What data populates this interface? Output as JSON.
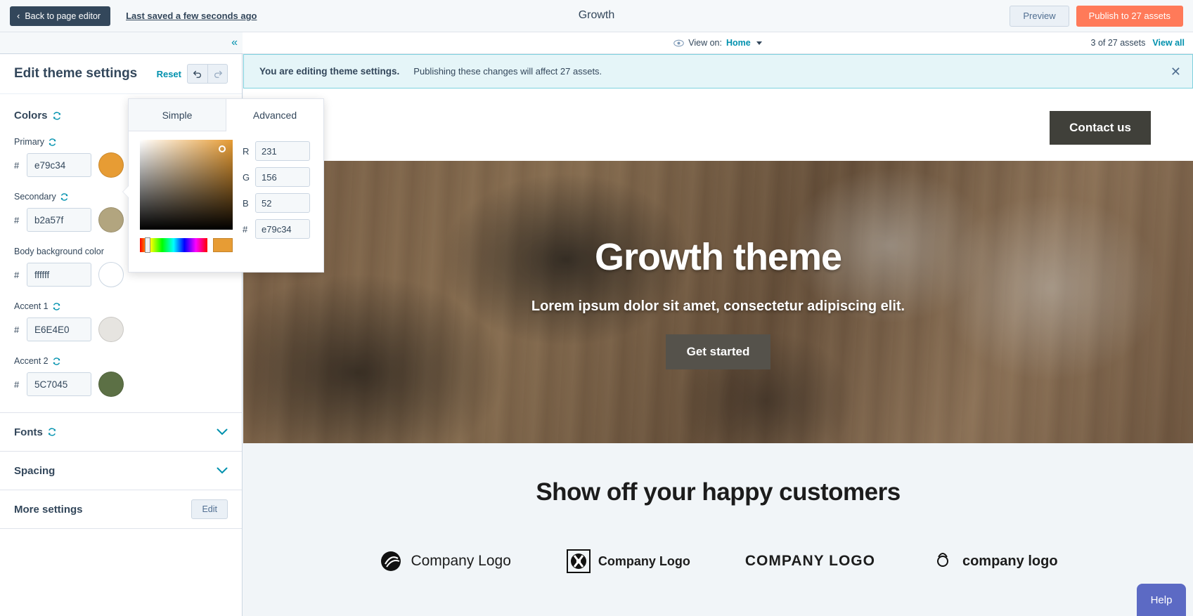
{
  "topbar": {
    "back_label": "Back to page editor",
    "back_chevron": "chevron-left-icon",
    "last_saved": "Last saved a few seconds ago",
    "page_title": "Growth",
    "preview_label": "Preview",
    "publish_label": "Publish to 27 assets",
    "publish_color": "#ff7a59",
    "back_color": "#33475b"
  },
  "secondbar": {
    "eye_icon": "eye-icon",
    "view_on_label": "View on:",
    "view_on_value": "Home",
    "assets_count": "3 of 27 assets",
    "view_all": "View all",
    "link_color": "#0091ae"
  },
  "sidebar": {
    "collapse_icon": "double-chevron-left-icon",
    "title": "Edit theme settings",
    "reset_label": "Reset",
    "undo_icon": "undo-icon",
    "redo_icon": "redo-icon",
    "colors_section": {
      "label": "Colors",
      "reset_icon": "refresh-icon",
      "fields": [
        {
          "label": "Primary",
          "has_reset": true,
          "reset_icon": "refresh-icon",
          "hash": "#",
          "value": "e79c34",
          "swatch": "#e79c34"
        },
        {
          "label": "Secondary",
          "has_reset": true,
          "reset_icon": "refresh-icon",
          "hash": "#",
          "value": "b2a57f",
          "swatch": "#b2a57f"
        },
        {
          "label": "Body background color",
          "has_reset": false,
          "reset_icon": "",
          "hash": "#",
          "value": "ffffff",
          "swatch": "#ffffff"
        },
        {
          "label": "Accent 1",
          "has_reset": true,
          "reset_icon": "refresh-icon",
          "hash": "#",
          "value": "E6E4E0",
          "swatch": "#E6E4E0"
        },
        {
          "label": "Accent 2",
          "has_reset": true,
          "reset_icon": "refresh-icon",
          "hash": "#",
          "value": "5C7045",
          "swatch": "#5C7045"
        }
      ]
    },
    "fonts_section": {
      "label": "Fonts",
      "reset_icon": "refresh-icon",
      "chevron": "chevron-down-icon"
    },
    "spacing_section": {
      "label": "Spacing",
      "chevron": "chevron-down-icon"
    },
    "more_settings": {
      "label": "More settings",
      "edit_label": "Edit"
    }
  },
  "picker": {
    "tab_simple": "Simple",
    "tab_advanced": "Advanced",
    "active_tab": "Advanced",
    "r_label": "R",
    "r_value": "231",
    "g_label": "G",
    "g_value": "156",
    "b_label": "B",
    "b_value": "52",
    "hex_label": "#",
    "hex_value": "e79c34",
    "current_color": "#e79c34"
  },
  "banner": {
    "bold_text": "You are editing theme settings.",
    "text": "Publishing these changes will affect 27 assets.",
    "close_icon": "close-icon",
    "background": "#e5f5f8"
  },
  "preview": {
    "contact_label": "Contact us",
    "hero_title": "Growth theme",
    "hero_subtitle": "Lorem ipsum dolor sit amet, consectetur adipiscing elit.",
    "hero_cta": "Get started",
    "customers_title": "Show off your happy customers",
    "logos": [
      {
        "mark": "company-logo-mark-1",
        "text": "Company Logo"
      },
      {
        "mark": "company-logo-mark-2",
        "text": "Company Logo"
      },
      {
        "mark": "company-logo-mark-3",
        "text": "COMPANY  LOGO"
      },
      {
        "mark": "company-logo-mark-4",
        "text": "company logo"
      }
    ]
  },
  "help": {
    "label": "Help",
    "color": "#5c6ac4"
  }
}
